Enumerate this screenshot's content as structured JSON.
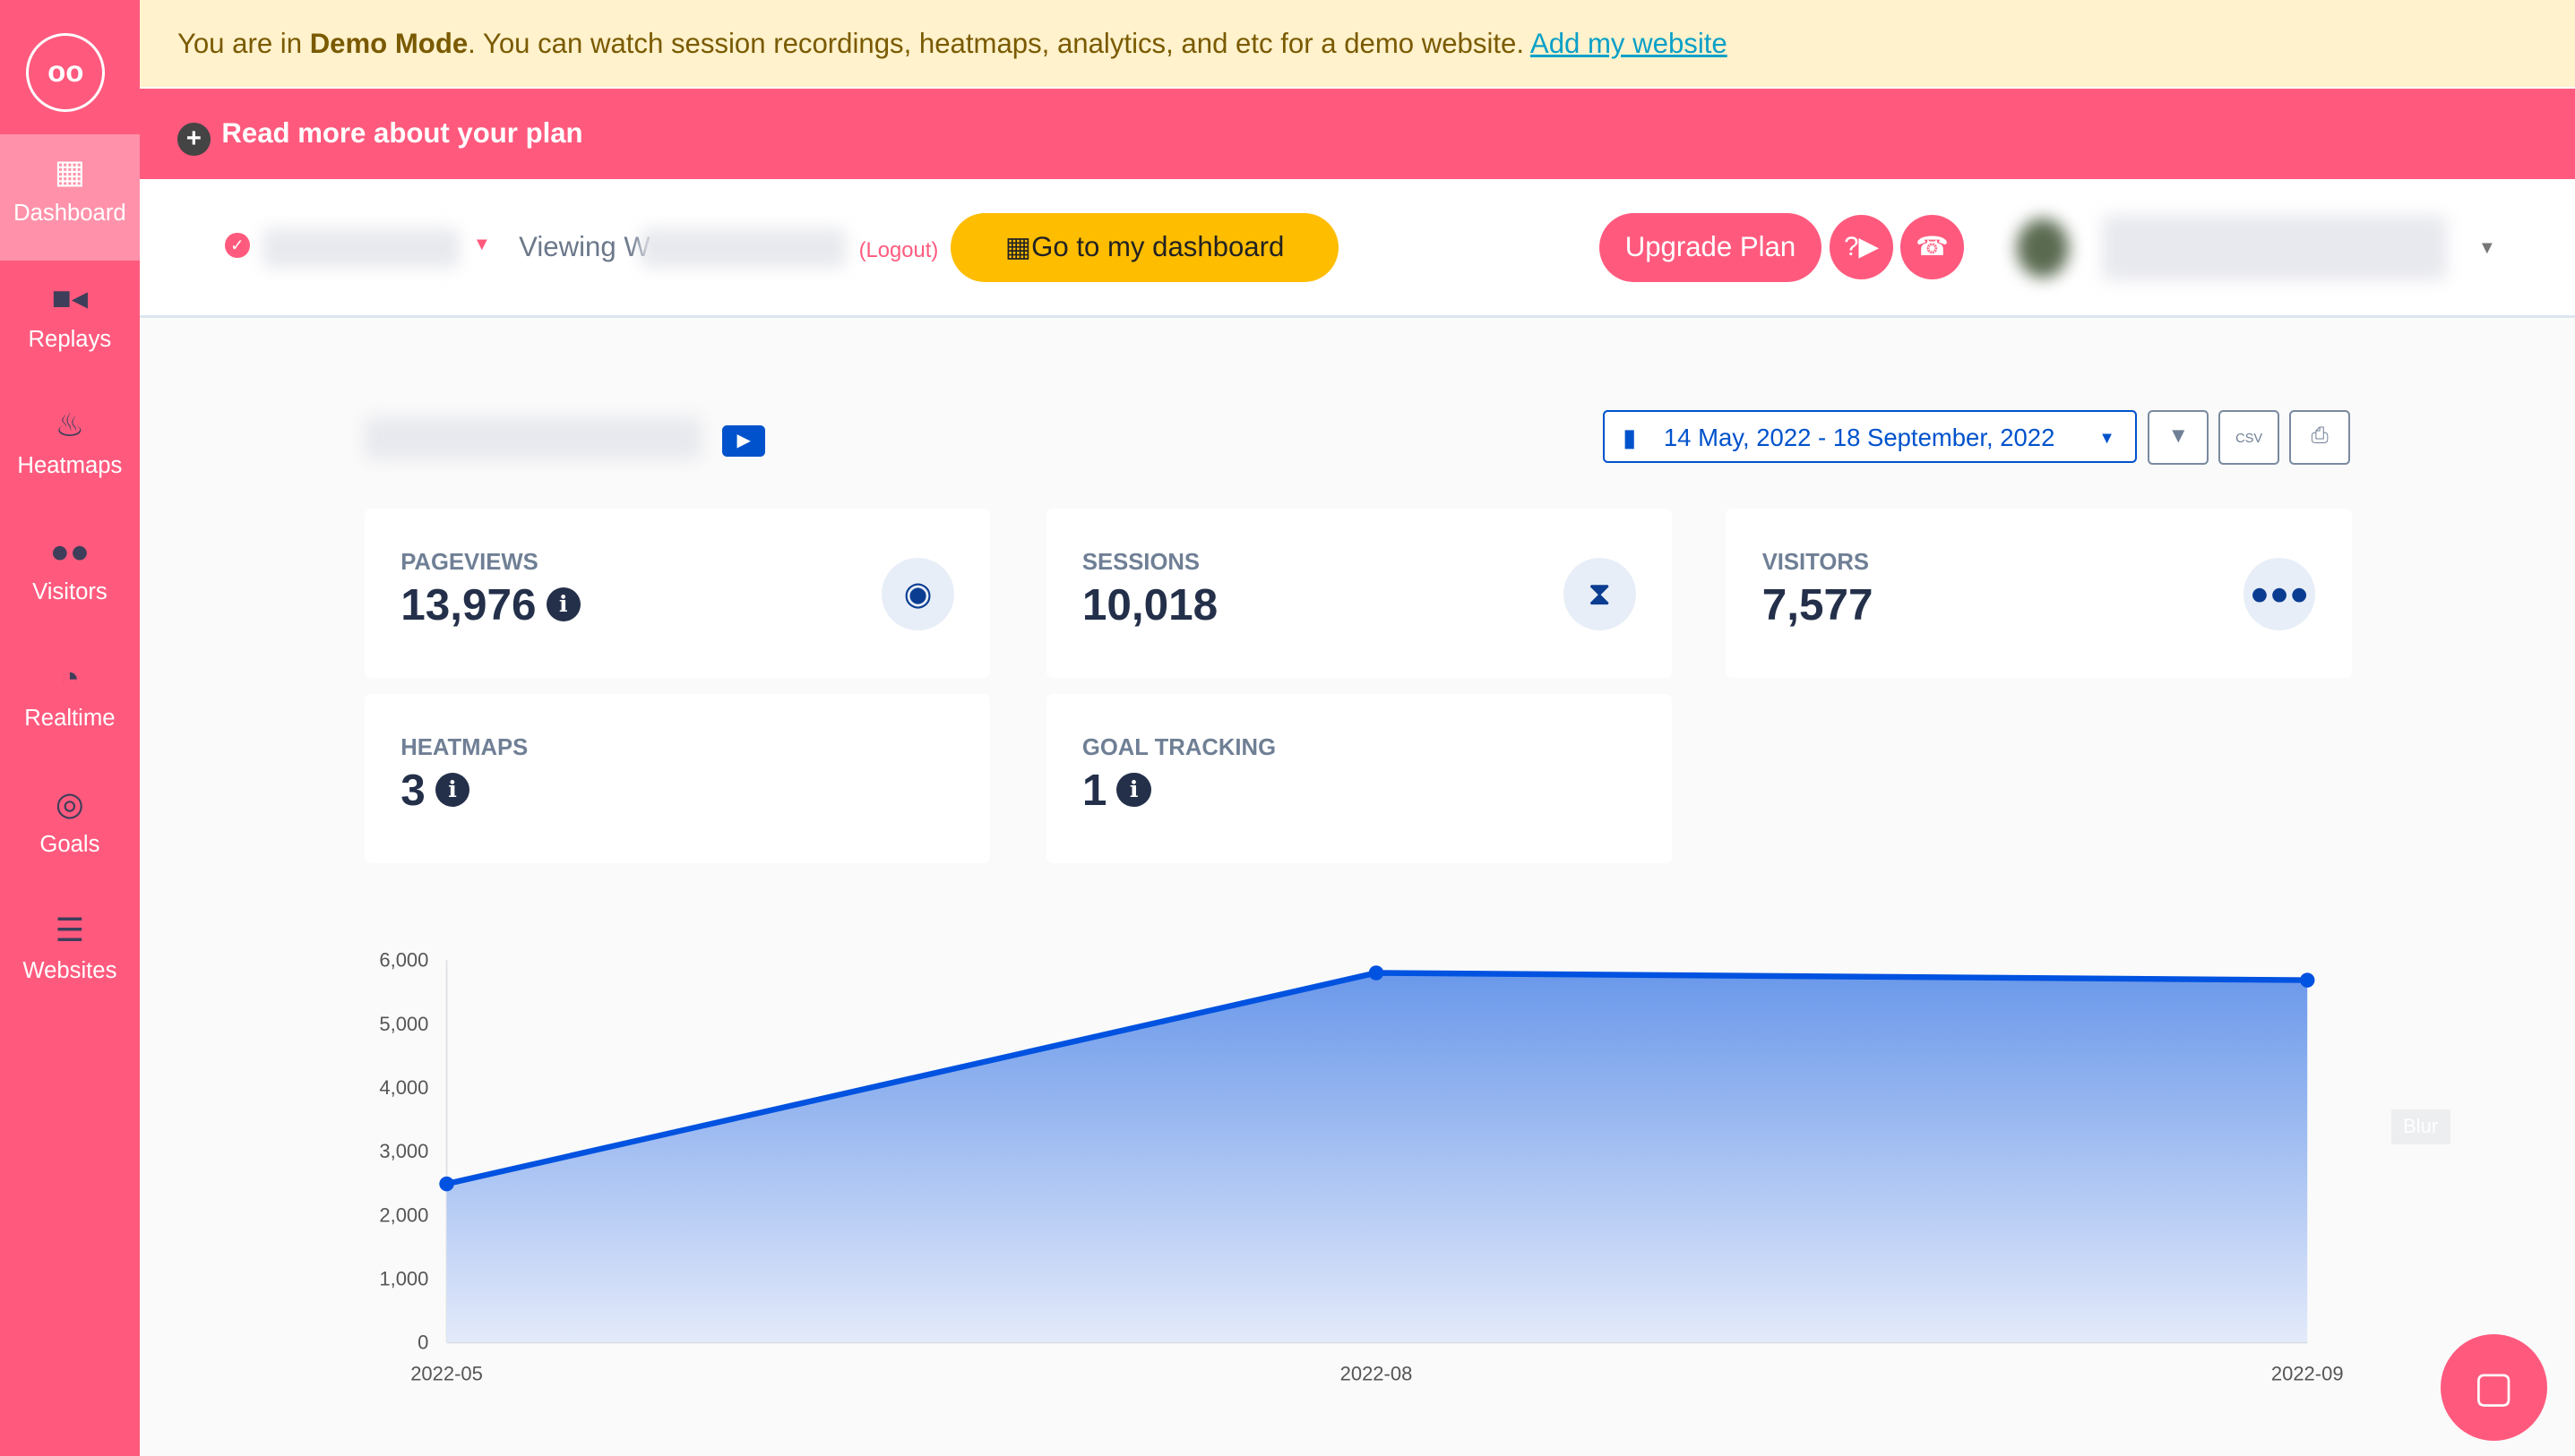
{
  "sidebar": {
    "logo": "oo",
    "items": [
      {
        "label": "Dashboard",
        "icon": "grid-icon",
        "active": true
      },
      {
        "label": "Replays",
        "icon": "video-icon"
      },
      {
        "label": "Heatmaps",
        "icon": "fire-icon"
      },
      {
        "label": "Visitors",
        "icon": "users-icon"
      },
      {
        "label": "Realtime",
        "icon": "clock-icon"
      },
      {
        "label": "Goals",
        "icon": "target-icon"
      },
      {
        "label": "Websites",
        "icon": "server-icon"
      }
    ]
  },
  "banner": {
    "pre": "You are in ",
    "bold": "Demo Mode",
    "post": ". You can watch session recordings, heatmaps, analytics, and etc for a demo website. ",
    "link": "Add my website"
  },
  "plan_bar": {
    "label": "Read more about your plan"
  },
  "topbar": {
    "viewing": "Viewing W",
    "logout": "(Logout)",
    "dashboard_btn": "Go to my dashboard",
    "upgrade": "Upgrade Plan"
  },
  "toolbar": {
    "date_range": "14 May, 2022 - 18 September, 2022",
    "csv": "CSV"
  },
  "stats": [
    {
      "label": "PAGEVIEWS",
      "value": "13,976",
      "icon": "eye-icon",
      "info": true
    },
    {
      "label": "SESSIONS",
      "value": "10,018",
      "icon": "hourglass-icon"
    },
    {
      "label": "VISITORS",
      "value": "7,577",
      "icon": "users-icon"
    },
    {
      "label": "HEATMAPS",
      "value": "3",
      "info": true
    },
    {
      "label": "GOAL TRACKING",
      "value": "1",
      "info": true
    }
  ],
  "blur_label": "Blur",
  "colors": {
    "brand": "#ff5a7e",
    "accent": "#0052cc",
    "yellow": "#ffbd00"
  },
  "chart_data": {
    "type": "area",
    "categories": [
      "2022-05",
      "2022-08",
      "2022-09"
    ],
    "values": [
      2490,
      5800,
      5686
    ],
    "ylim": [
      0,
      6000
    ],
    "yticks": [
      "0",
      "1,000",
      "2,000",
      "3,000",
      "4,000",
      "5,000",
      "6,000"
    ],
    "grid": false
  }
}
